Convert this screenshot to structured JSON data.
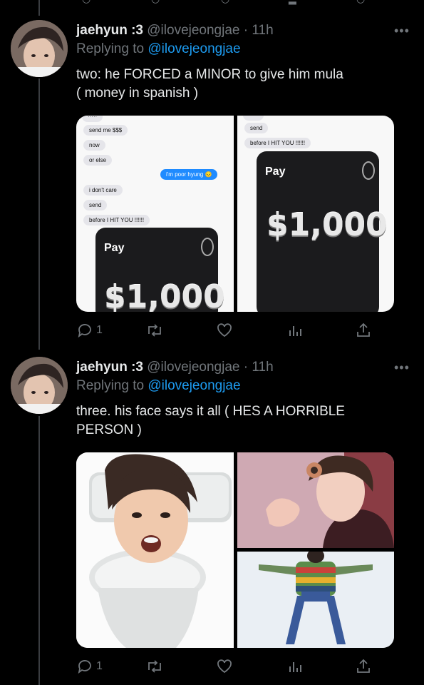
{
  "tweets": [
    {
      "name": "jaehyun :3",
      "handle": "@ilovejeongjae",
      "sep": "·",
      "time": "11h",
      "replying_prefix": "Replying to",
      "replying_handle": "@ilovejeongjae",
      "text_line1": "two: he FORCED a MINOR to give him mula",
      "text_line2": "( money in spanish )",
      "more": "•••",
      "reply_count": "1",
      "media_left": {
        "bubbles": [
          "send me $$$",
          "now",
          "or else",
          "i'm poor hyung 😔",
          "i don't care",
          "send",
          "before I HIT YOU !!!!!!"
        ],
        "pay": "Pay",
        "amount": "$1,000"
      },
      "media_right": {
        "bubbles": [
          "send",
          "before I HIT YOU !!!!!!"
        ],
        "pay": "Pay",
        "amount": "$1,000"
      }
    },
    {
      "name": "jaehyun :3",
      "handle": "@ilovejeongjae",
      "sep": "·",
      "time": "11h",
      "replying_prefix": "Replying to",
      "replying_handle": "@ilovejeongjae",
      "text_line1": "three. his face says it all ( HES A HORRIBLE",
      "text_line2": "PERSON )",
      "more": "•••",
      "reply_count": "1"
    }
  ],
  "icons": [
    "reply-icon",
    "retweet-icon",
    "like-icon",
    "analytics-icon",
    "share-icon"
  ],
  "colors": {
    "background": "#000000",
    "link": "#1d9bf0",
    "muted": "#71767b",
    "text": "#e7e9ea"
  }
}
